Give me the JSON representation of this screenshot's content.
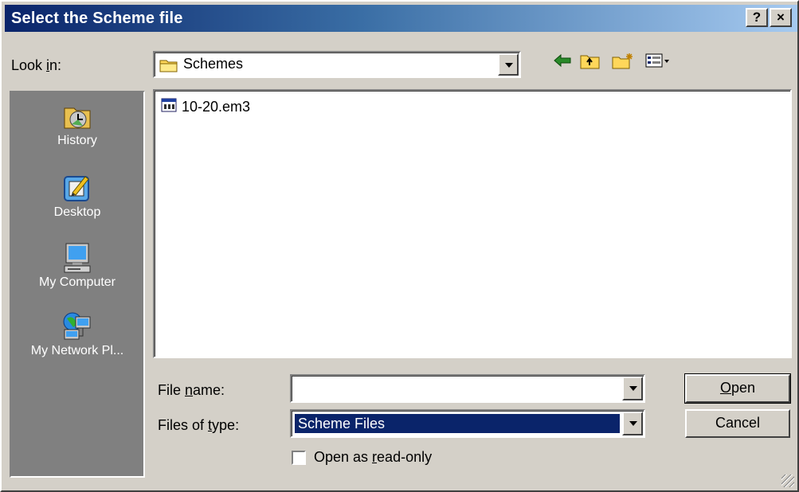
{
  "window": {
    "title": "Select the Scheme file",
    "help_button": "?",
    "close_button": "×"
  },
  "look_in": {
    "label_prefix": "Look ",
    "label_hotkey": "i",
    "label_suffix": "n:",
    "value": "Schemes"
  },
  "places": [
    {
      "label": "History",
      "icon": "history-icon"
    },
    {
      "label": "Desktop",
      "icon": "desktop-icon"
    },
    {
      "label": "My Computer",
      "icon": "my-computer-icon"
    },
    {
      "label": "My Network Pl...",
      "icon": "network-places-icon"
    }
  ],
  "files": [
    {
      "name": "10-20.em3",
      "icon": "scheme-file-icon"
    }
  ],
  "file_name": {
    "label_prefix": "File ",
    "label_hotkey": "n",
    "label_suffix": "ame:",
    "value": ""
  },
  "file_type": {
    "label_prefix": "Files of ",
    "label_hotkey": "t",
    "label_suffix": "ype:",
    "value": "Scheme Files"
  },
  "read_only": {
    "label_prefix": "Open as ",
    "label_hotkey": "r",
    "label_suffix": "ead-only",
    "checked": false
  },
  "buttons": {
    "open_hotkey": "O",
    "open_rest": "pen",
    "cancel": "Cancel"
  },
  "colors": {
    "title_start": "#0a246a",
    "title_end": "#a6caf0",
    "face": "#d4d0c8",
    "selection": "#0a246a"
  }
}
